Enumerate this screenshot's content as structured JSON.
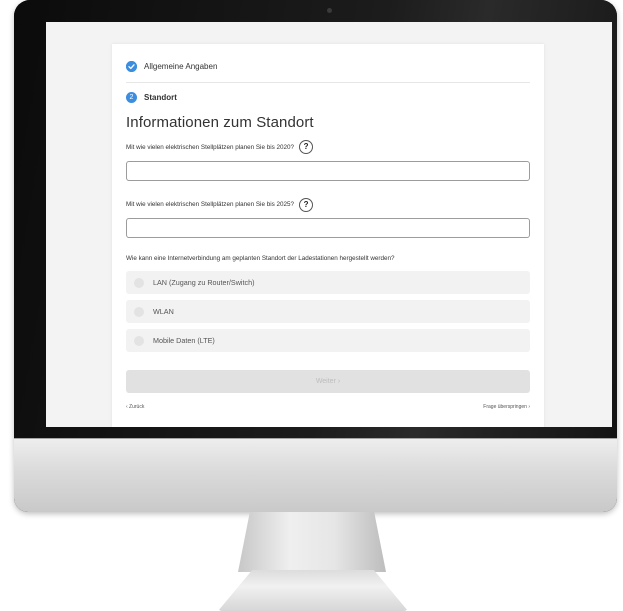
{
  "steps": [
    {
      "label": "Allgemeine Angaben",
      "state": "completed",
      "number": ""
    },
    {
      "label": "Standort",
      "state": "active",
      "number": "2"
    }
  ],
  "section_title": "Informationen zum Standort",
  "questions": {
    "q1": {
      "label": "Mit wie vielen elektrischen Stellplätzen planen Sie bis 2020?",
      "help": "?",
      "value": ""
    },
    "q2": {
      "label": "Mit wie vielen elektrischen Stellplätzen planen Sie bis 2025?",
      "help": "?",
      "value": ""
    },
    "q3": {
      "label": "Wie kann eine Internetverbindung am geplanten Standort der Ladestationen hergestellt werden?",
      "options": [
        "LAN (Zugang zu Router/Switch)",
        "WLAN",
        "Mobile Daten (LTE)"
      ]
    }
  },
  "buttons": {
    "next": "Weiter ›",
    "back": "‹ Zurück",
    "skip": "Frage überspringen ›"
  },
  "icons": {
    "step_done": "check-circle-icon",
    "help": "question-circle-icon"
  },
  "colors": {
    "accent": "#3b8de0",
    "disabled_button": "#e1e1e1",
    "option_bg": "#f2f2f2"
  }
}
